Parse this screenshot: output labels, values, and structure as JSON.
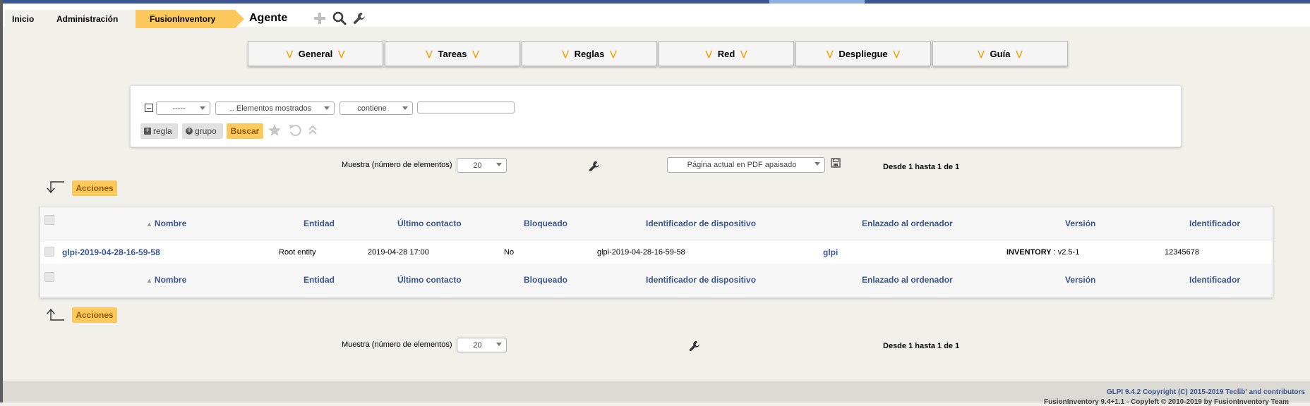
{
  "breadcrumb": {
    "home": "Inicio",
    "admin": "Administración",
    "plugin": "FusionInventory"
  },
  "page_title": "Agente",
  "header_icons": [
    "plus-icon",
    "search-icon",
    "wrench-icon"
  ],
  "menu": {
    "tabs": [
      "General",
      "Tareas",
      "Reglas",
      "Red",
      "Despliegue",
      "Guía"
    ]
  },
  "search": {
    "field1": "-----",
    "field2": ".. Elementos mostrados",
    "operator": "contiene",
    "value": "",
    "add_rule": "regla",
    "add_group": "grupo",
    "search_button": "Buscar"
  },
  "pager_top": {
    "show_label": "Muestra (número de elementos)",
    "show_value": "20",
    "export_option": "Página actual en PDF apaisado",
    "range": "Desde 1 hasta 1 de 1"
  },
  "actions_label": "Acciones",
  "table": {
    "columns": [
      "Nombre",
      "Entidad",
      "Último contacto",
      "Bloqueado",
      "Identificador de dispositivo",
      "Enlazado al ordenador",
      "Versión",
      "Identificador"
    ],
    "rows": [
      {
        "name": "glpi-2019-04-28-16-59-58",
        "entity": "Root entity",
        "last_contact": "2019-04-28 17:00",
        "locked": "No",
        "device_id": "glpi-2019-04-28-16-59-58",
        "linked_computer": "glpi",
        "version_key": "INVENTORY",
        "version_value": ": v2.5-1",
        "identifier": "12345678"
      }
    ]
  },
  "pager_bottom": {
    "show_label": "Muestra (número de elementos)",
    "show_value": "20",
    "range": "Desde 1 hasta 1 de 1"
  },
  "footer": {
    "copyright": "GLPI 9.4.2 Copyright (C) 2015-2019 Teclib' and contributors",
    "plugin_line": "FusionInventory 9.4+1.1 - Copyleft © 2010-2019 by FusionInventory Team"
  },
  "colors": {
    "brand_blue": "#3a5693",
    "accent_yellow": "#fec95c",
    "chevron_orange": "#f3a100"
  }
}
